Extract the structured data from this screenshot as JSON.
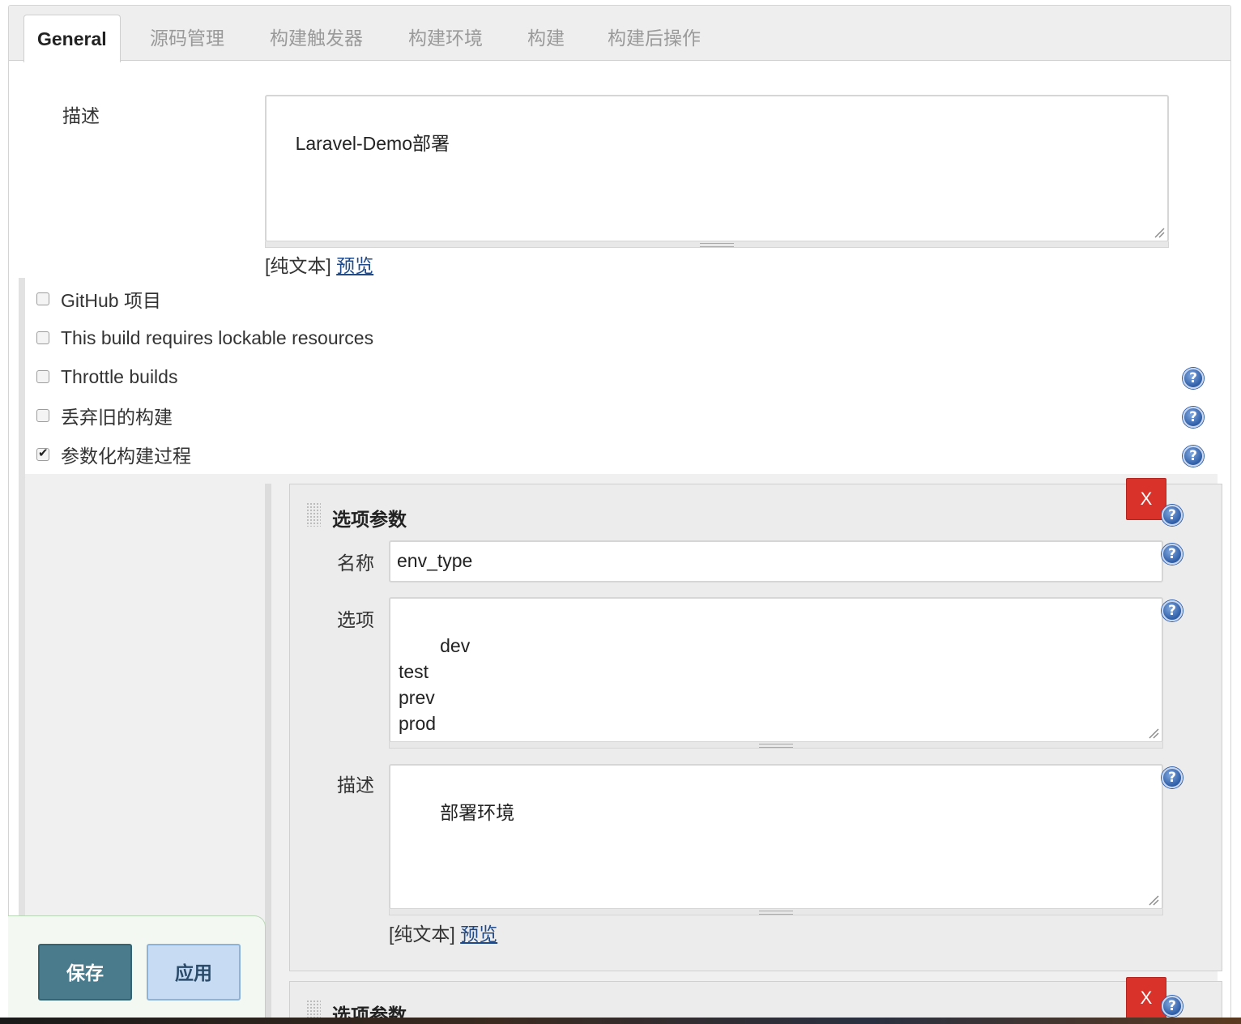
{
  "tabs": [
    {
      "label": "General",
      "active": true
    },
    {
      "label": "源码管理"
    },
    {
      "label": "构建触发器"
    },
    {
      "label": "构建环境"
    },
    {
      "label": "构建"
    },
    {
      "label": "构建后操作"
    }
  ],
  "description": {
    "label": "描述",
    "value": "Laravel-Demo部署",
    "format_prefix": "[纯文本]",
    "preview_link": "预览"
  },
  "options": [
    {
      "label": "GitHub 项目",
      "checked": false,
      "help": false
    },
    {
      "label": "This build requires lockable resources",
      "checked": false,
      "help": false
    },
    {
      "label": "Throttle builds",
      "checked": false,
      "help": true
    },
    {
      "label": "丢弃旧的构建",
      "checked": false,
      "help": true
    },
    {
      "label": "参数化构建过程",
      "checked": true,
      "help": true
    }
  ],
  "parameters": [
    {
      "title": "选项参数",
      "remove_label": "X",
      "name_label": "名称",
      "name_value": "env_type",
      "choices_label": "选项",
      "choices_value": "dev\ntest\nprev\nprod",
      "desc_label": "描述",
      "desc_value": "部署环境",
      "format_prefix": "[纯文本]",
      "preview_link": "预览"
    },
    {
      "title": "选项参数",
      "remove_label": "X"
    }
  ],
  "actions": {
    "save_label": "保存",
    "apply_label": "应用"
  },
  "help_glyph": "?",
  "icons": [
    "help-icon",
    "drag-handle-icon",
    "resize-grip-icon",
    "checkbox-icon"
  ],
  "colors": {
    "remove_button": "#d9322b",
    "save_button": "#4a7b8c",
    "apply_button": "#c7dcf2",
    "link": "#204a87"
  }
}
